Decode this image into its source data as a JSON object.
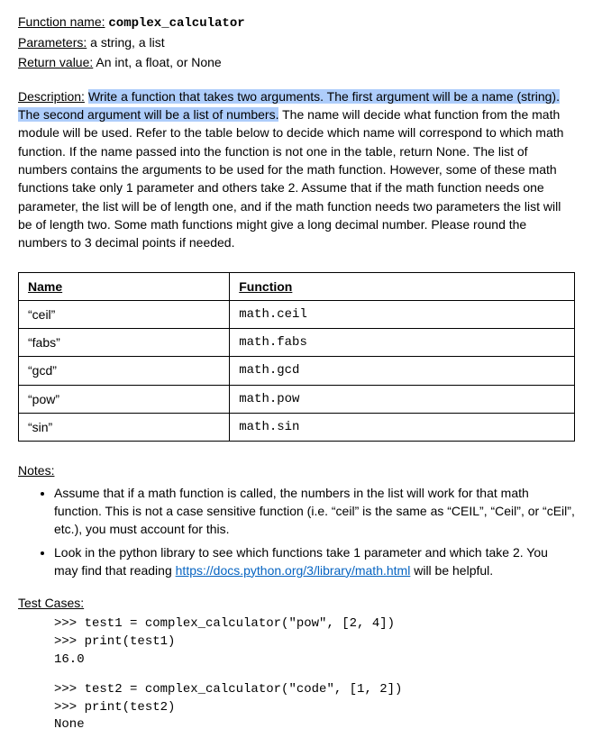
{
  "header": {
    "func_label": "Function name:",
    "func_name": "complex_calculator",
    "params_label": "Parameters:",
    "params_value": "a string, a list",
    "return_label": "Return value:",
    "return_value": "An int, a float, or None"
  },
  "description": {
    "label": "Description:",
    "highlight1": "Write a function that takes two arguments. The first argument will be a name (string). The ",
    "highlight2_pre": "second argument will be a list of numbers.",
    "rest": " The name will decide what function from the math module will be used. Refer to the table below to decide which name will correspond to which math function. If the name passed into the function is not one in the table, return None. The list of numbers contains the arguments to be used for the math function. However, some of these math functions take only 1 parameter and others take 2. Assume that if the math function needs one parameter, the list will be of length one, and if the math function needs two parameters the list will be of length two. Some math functions might give a long decimal number. Please round the numbers to 3 decimal points if needed."
  },
  "table": {
    "headers": {
      "name": "Name",
      "func": "Function"
    },
    "rows": [
      {
        "name": "“ceil”",
        "func": "math.ceil"
      },
      {
        "name": "“fabs”",
        "func": "math.fabs"
      },
      {
        "name": "“gcd”",
        "func": "math.gcd"
      },
      {
        "name": "“pow”",
        "func": "math.pow"
      },
      {
        "name": "“sin”",
        "func": "math.sin"
      }
    ]
  },
  "notes": {
    "label": "Notes:",
    "item1": "Assume that if a math function is called, the numbers in the list will work for that math function. This is not a case sensitive function (i.e. “ceil” is the same as “CEIL”, “Ceil”, or “cEil”, etc.), you must account for this.",
    "item2_pre": "Look in the python library to see which functions take 1 parameter and which take 2. You may find that reading ",
    "item2_link": "https://docs.python.org/3/library/math.html",
    "item2_post": " will be helpful."
  },
  "tests": {
    "label": "Test Cases:",
    "block1": ">>> test1 = complex_calculator(\"pow\", [2, 4])\n>>> print(test1)\n16.0",
    "block2": ">>> test2 = complex_calculator(\"code\", [1, 2])\n>>> print(test2)\nNone"
  }
}
